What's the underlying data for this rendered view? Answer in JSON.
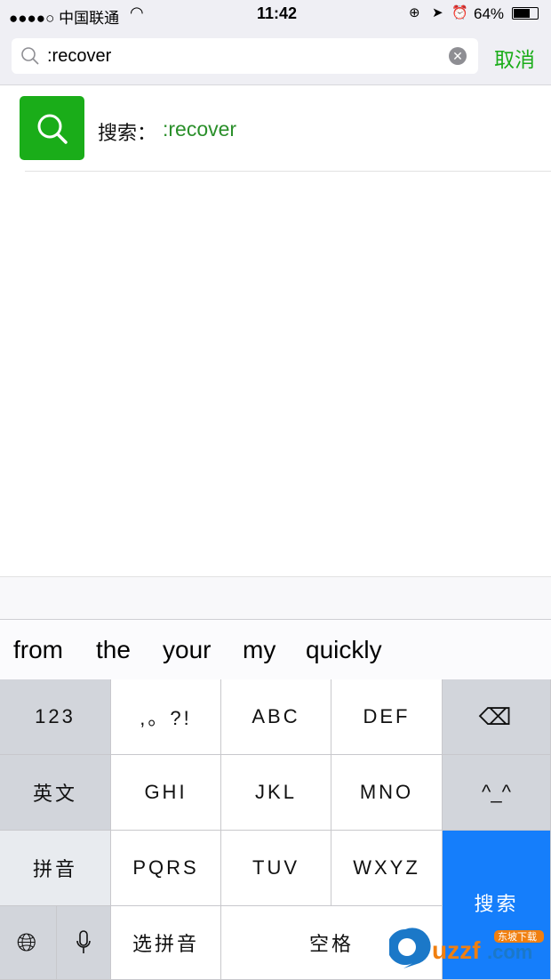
{
  "status": {
    "carrier": "●●●●○ 中国联通",
    "time": "11:42",
    "battery": "64%"
  },
  "search": {
    "value": ":recover",
    "cancel": "取消"
  },
  "result": {
    "prefix": "搜索：",
    "query": ":recover"
  },
  "suggestions": [
    "from",
    "the",
    "your",
    "my",
    "quickly"
  ],
  "keyboard": {
    "k123": "123",
    "punct": ",。?!",
    "abc": "ABC",
    "def": "DEF",
    "english": "英文",
    "ghi": "GHI",
    "jkl": "JKL",
    "mno": "MNO",
    "emoji": "^_^",
    "pinyin": "拼音",
    "pqrs": "PQRS",
    "tuv": "TUV",
    "wxyz": "WXYZ",
    "search": "搜索",
    "select_pinyin": "选拼音",
    "space": "空格"
  },
  "watermark": {
    "text": "uzzf.com",
    "sub": "东坡下载"
  },
  "colors": {
    "accent": "#1aad19",
    "green_text": "#2a8f2a",
    "key_blue": "#157efb"
  }
}
